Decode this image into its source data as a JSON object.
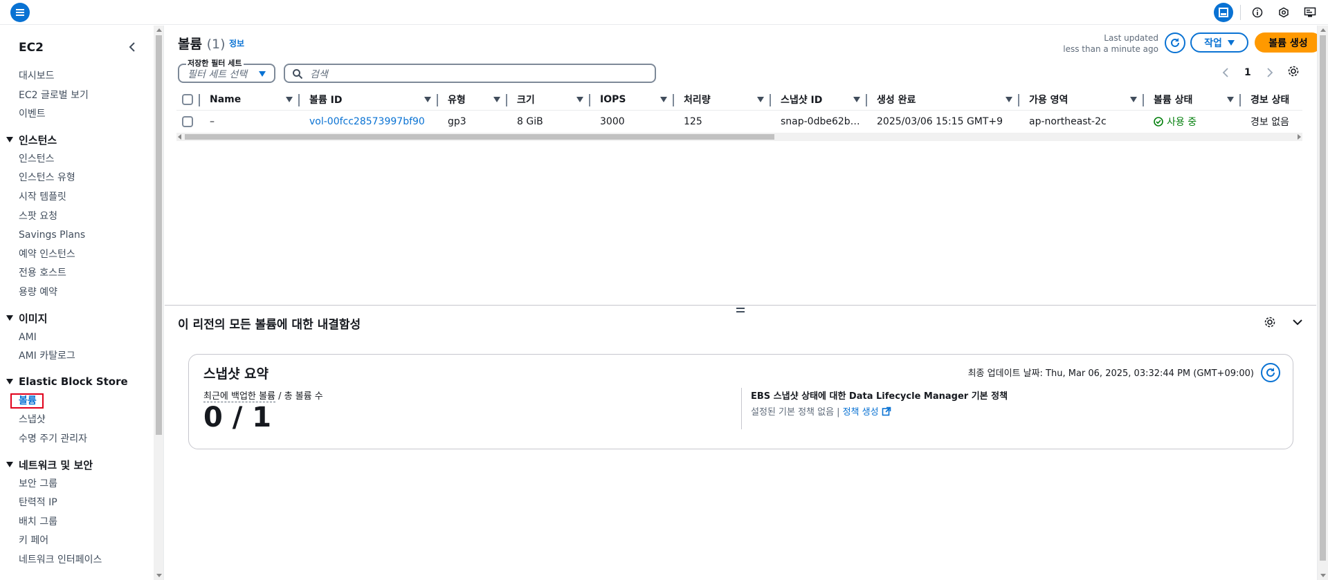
{
  "topbar": {
    "icons": [
      "menu-icon",
      "split-panel-icon",
      "info-icon",
      "hexagon-settings-icon",
      "feedback-icon"
    ]
  },
  "sidebar": {
    "title": "EC2",
    "top_items": [
      "대시보드",
      "EC2 글로벌 보기",
      "이벤트"
    ],
    "sections": [
      {
        "title": "인스턴스",
        "items": [
          "인스턴스",
          "인스턴스 유형",
          "시작 템플릿",
          "스팟 요청",
          "Savings Plans",
          "예약 인스턴스",
          "전용 호스트",
          "용량 예약"
        ]
      },
      {
        "title": "이미지",
        "items": [
          "AMI",
          "AMI 카탈로그"
        ]
      },
      {
        "title": "Elastic Block Store",
        "items": [
          "볼륨",
          "스냅샷",
          "수명 주기 관리자"
        ]
      },
      {
        "title": "네트워크 및 보안",
        "items": [
          "보안 그룹",
          "탄력적 IP",
          "배치 그룹",
          "키 페어",
          "네트워크 인터페이스"
        ]
      }
    ],
    "active_item": "볼륨"
  },
  "header": {
    "title": "볼륨",
    "count": "(1)",
    "info_link": "정보",
    "last_updated_label": "Last updated",
    "last_updated_value": "less than a minute ago",
    "action_button": "작업",
    "create_button": "볼륨 생성"
  },
  "filters": {
    "filter_set_label": "저장한 필터 세트",
    "filter_set_placeholder": "필터 세트 선택",
    "search_placeholder": "검색"
  },
  "pagination": {
    "current_page": "1"
  },
  "table": {
    "columns": [
      "Name",
      "볼륨 ID",
      "유형",
      "크기",
      "IOPS",
      "처리량",
      "스냅샷 ID",
      "생성 완료",
      "가용 영역",
      "볼륨 상태",
      "경보 상태"
    ],
    "rows": [
      {
        "name": "–",
        "volume_id": "vol-00fcc28573997bf90",
        "type": "gp3",
        "size": "8 GiB",
        "iops": "3000",
        "throughput": "125",
        "snapshot_id": "snap-0dbe62b…",
        "created": "2025/03/06 15:15 GMT+9",
        "az": "ap-northeast-2c",
        "state": "사용 중",
        "alarm": "경보 없음"
      }
    ]
  },
  "bottom_panel": {
    "title": "이 리전의 모든 볼륨에 대한 내결함성",
    "card": {
      "title": "스냅샷 요약",
      "updated": "최종 업데이트 날짜: Thu, Mar 06, 2025, 03:32:44 PM (GMT+09:00)",
      "label_underlined": "최근에 백업한 볼륨",
      "label_rest": " / 총 볼륨 수",
      "value": "0 / 1",
      "right_title": "EBS 스냅샷 상태에 대한 Data Lifecycle Manager 기본 정책",
      "right_sub": "설정된 기본 정책 없음 |",
      "right_link": "정책 생성"
    }
  },
  "colors": {
    "accent": "#0972d3",
    "primary_button": "#ff9900",
    "success": "#037f0c",
    "highlight_box": "#e0001b"
  }
}
